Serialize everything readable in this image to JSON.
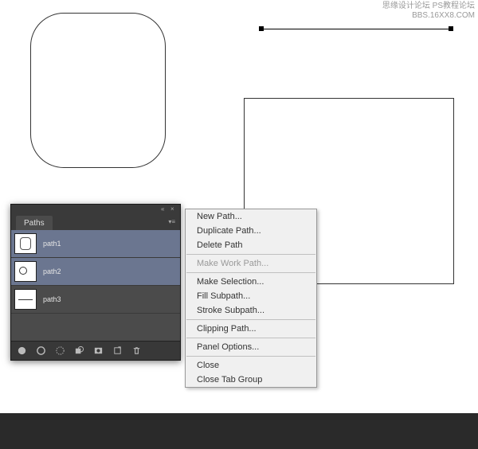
{
  "watermark": {
    "line1": "思缘设计论坛  PS教程论坛",
    "line2": "BBS.16XX8.COM"
  },
  "panel": {
    "tab": "Paths",
    "items": [
      {
        "name": "path1",
        "thumb": "round",
        "selected": true
      },
      {
        "name": "path2",
        "thumb": "circ",
        "selected": true
      },
      {
        "name": "path3",
        "thumb": "line",
        "selected": false
      }
    ]
  },
  "context_menu": {
    "items": [
      {
        "label": "New Path...",
        "enabled": true
      },
      {
        "label": "Duplicate Path...",
        "enabled": true
      },
      {
        "label": "Delete Path",
        "enabled": true
      },
      {
        "sep": true
      },
      {
        "label": "Make Work Path...",
        "enabled": false
      },
      {
        "sep": true
      },
      {
        "label": "Make Selection...",
        "enabled": true
      },
      {
        "label": "Fill Subpath...",
        "enabled": true
      },
      {
        "label": "Stroke Subpath...",
        "enabled": true
      },
      {
        "sep": true
      },
      {
        "label": "Clipping Path...",
        "enabled": true
      },
      {
        "sep": true
      },
      {
        "label": "Panel Options...",
        "enabled": true
      },
      {
        "sep": true
      },
      {
        "label": "Close",
        "enabled": true
      },
      {
        "label": "Close Tab Group",
        "enabled": true
      }
    ]
  },
  "footer_icons": [
    "fill-circle-icon",
    "stroke-circle-icon",
    "selection-icon",
    "overlay-icon",
    "mask-icon",
    "new-icon",
    "trash-icon"
  ]
}
